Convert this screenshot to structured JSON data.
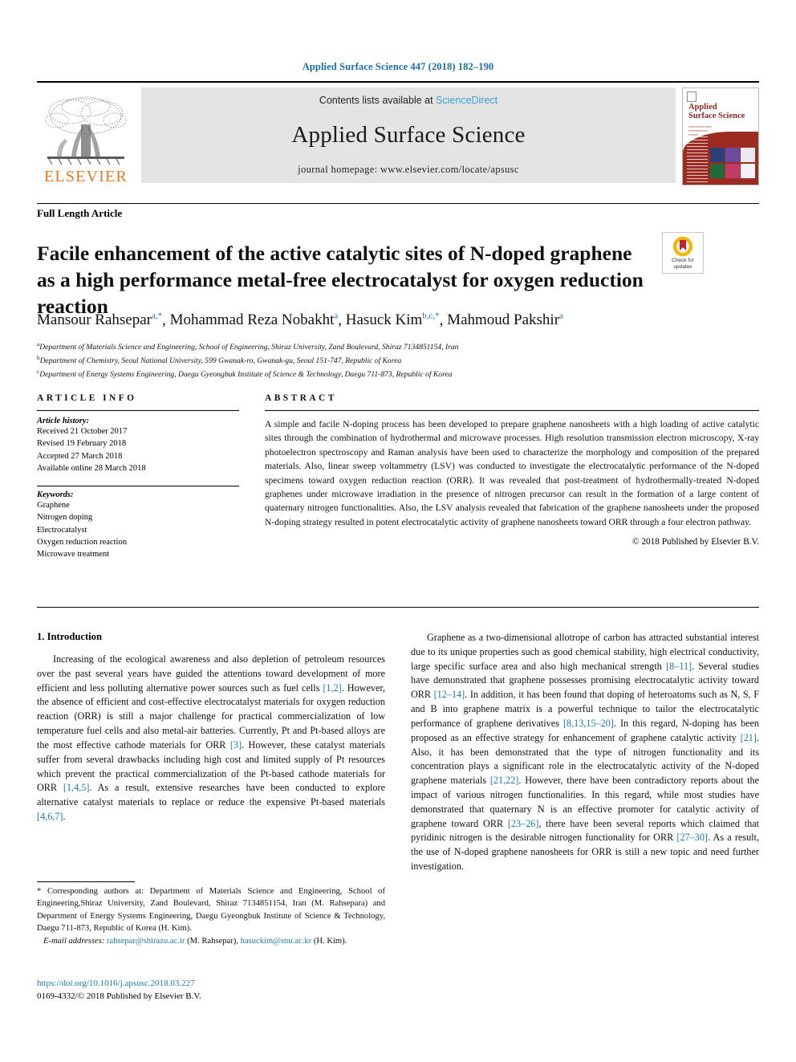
{
  "running_head": "Applied Surface Science 447 (2018) 182–190",
  "banner": {
    "publisher_name": "ELSEVIER",
    "contents_prefix": "Contents lists available at ",
    "sciencedirect": "ScienceDirect",
    "journal_title": "Applied Surface Science",
    "homepage": "journal homepage: www.elsevier.com/locate/apsusc",
    "cover": {
      "title_line1": "Applied",
      "title_line2": "Surface Science"
    }
  },
  "article": {
    "type": "Full Length Article",
    "title": "Facile enhancement of the active catalytic sites of N-doped graphene as a high performance metal-free electrocatalyst for oxygen reduction reaction",
    "crossmark_line1": "Check for",
    "crossmark_line2": "updates"
  },
  "authors": [
    {
      "name": "Mansour Rahsepar",
      "marks": "a,*"
    },
    {
      "name": "Mohammad Reza Nobakht",
      "marks": "a"
    },
    {
      "name": "Hasuck Kim",
      "marks": "b,c,*"
    },
    {
      "name": "Mahmoud Pakshir",
      "marks": "a"
    }
  ],
  "affiliations": [
    {
      "mark": "a",
      "text": "Department of Materials Science and Engineering, School of Engineering, Shiraz University, Zand Boulevard, Shiraz 7134851154, Iran"
    },
    {
      "mark": "b",
      "text": "Department of Chemistry, Seoul National University, 599 Gwanak-ro, Gwanak-gu, Seoul 151-747, Republic of Korea"
    },
    {
      "mark": "c",
      "text": "Department of Energy Systems Engineering, Daegu Gyeongbuk Institute of Science & Technology, Daegu 711-873, Republic of Korea"
    }
  ],
  "article_info": {
    "heading": "ARTICLE INFO",
    "history_title": "Article history:",
    "history": [
      "Received 21 October 2017",
      "Revised 19 February 2018",
      "Accepted 27 March 2018",
      "Available online 28 March 2018"
    ],
    "keywords_title": "Keywords:",
    "keywords": [
      "Graphene",
      "Nitrogen doping",
      "Electrocatalyst",
      "Oxygen reduction reaction",
      "Microwave treatment"
    ]
  },
  "abstract": {
    "heading": "ABSTRACT",
    "text": "A simple and facile N-doping process has been developed to prepare graphene nanosheets with a high loading of active catalytic sites through the combination of hydrothermal and microwave processes. High resolution transmission electron microscopy, X-ray photoelectron spectroscopy and Raman analysis have been used to characterize the morphology and composition of the prepared materials. Also, linear sweep voltammetry (LSV) was conducted to investigate the electrocatalytic performance of the N-doped specimens toward oxygen reduction reaction (ORR). It was revealed that post-treatment of hydrothermally-treated N-doped graphenes under microwave irradiation in the presence of nitrogen precursor can result in the formation of a large content of quaternary nitrogen functionalities. Also, the LSV analysis revealed that fabrication of the graphene nanosheets under the proposed N-doping strategy resulted in potent electrocatalytic activity of graphene nanosheets toward ORR through a four electron pathway.",
    "copyright": "© 2018 Published by Elsevier B.V."
  },
  "body": {
    "section_heading": "1. Introduction",
    "left_paragraphs": [
      "Increasing of the ecological awareness and also depletion of petroleum resources over the past several years have guided the attentions toward development of more efficient and less polluting alternative power sources such as fuel cells [1,2]. However, the absence of efficient and cost-effective electrocatalyst materials for oxygen reduction reaction (ORR) is still a major challenge for practical commercialization of low temperature fuel cells and also metal-air batteries. Currently, Pt and Pt-based alloys are the most effective cathode materials for ORR [3]. However, these catalyst materials suffer from several drawbacks including high cost and limited supply of Pt resources which prevent the practical commercialization of the Pt-based cathode materials for ORR [1,4,5]. As a result, extensive researches have been conducted to explore alternative catalyst materials to replace or reduce the expensive Pt-based materials [4,6,7]."
    ],
    "right_paragraphs": [
      "Graphene as a two-dimensional allotrope of carbon has attracted substantial interest due to its unique properties such as good chemical stability, high electrical conductivity, large specific surface area and also high mechanical strength [8–11]. Several studies have demonstrated that graphene possesses promising electrocatalytic activity toward ORR [12–14]. In addition, it has been found that doping of heteroatoms such as N, S, F and B into graphene matrix is a powerful technique to tailor the electrocatalytic performance of graphene derivatives [8,13,15–20]. In this regard, N-doping has been proposed as an effective strategy for enhancement of graphene catalytic activity [21]. Also, it has been demonstrated that the type of nitrogen functionality and its concentration plays a significant role in the electrocatalytic activity of the N-doped graphene materials [21,22]. However, there have been contradictory reports about the impact of various nitrogen functionalities. In this regard, while most studies have demonstrated that quaternary N is an effective promoter for catalytic activity of graphene toward ORR [23–26], there have been several reports which claimed that pyridinic nitrogen is the desirable nitrogen functionality for ORR [27–30]. As a result, the use of N-doped graphene nanosheets for ORR is still a new topic and need further investigation."
    ]
  },
  "footnotes": {
    "corresponding": "* Corresponding authors at: Department of Materials Science and Engineering, School of Engineering,Shiraz University, Zand Boulevard, Shiraz 7134851154, Iran (M. Rahsepara) and Department of Energy Systems Engineering, Daegu Gyeongbuk Institute of Science & Technology, Daegu 711-873, Republic of Korea (H. Kim).",
    "email_label": "E-mail addresses:",
    "email1": "rahsepar@shirazu.ac.ir",
    "email1_owner": "(M. Rahsepar),",
    "email2": "hasuckim@snu.ac.kr",
    "email2_owner": "(H. Kim)."
  },
  "doi_block": {
    "doi": "https://doi.org/10.1016/j.apsusc.2018.03.227",
    "issn_line": "0169-4332/© 2018 Published by Elsevier B.V."
  },
  "colors": {
    "link_blue": "#1a7ba8",
    "header_blue": "#1a6fa8",
    "sciencedirect_blue": "#3a9fd4",
    "elsevier_orange": "#E87722",
    "banner_gray": "#e4e4e4",
    "cover_red": "#9c2b22"
  }
}
